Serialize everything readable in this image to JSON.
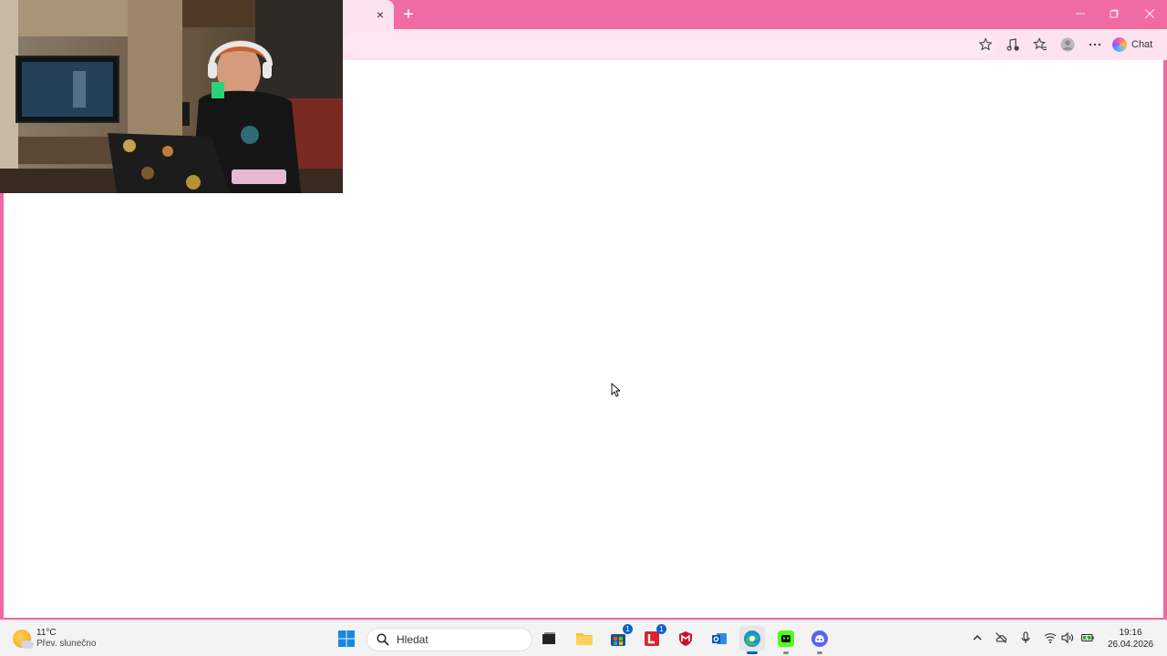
{
  "taskbar": {
    "weather": {
      "temperature": "11°C",
      "condition": "Přev. slunečno"
    },
    "search_placeholder": "Hledat",
    "store_badge": "1",
    "office_badge": "1",
    "clock": {
      "time": "19:16",
      "date": "26.04.2026"
    }
  },
  "browser": {
    "chat_label": "Chat",
    "tab_close": "×",
    "new_tab": "+"
  },
  "colors": {
    "accent": "#f06aa4",
    "toolbar": "#fde3ef",
    "taskbar": "#f3f3f3"
  }
}
